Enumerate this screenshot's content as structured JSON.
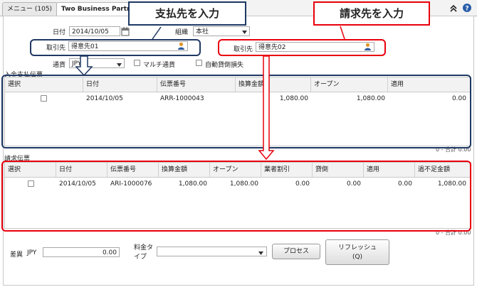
{
  "tabs": [
    {
      "label": "メニュー (105)",
      "active": false
    },
    {
      "label": "Two Business Partner",
      "active": true
    }
  ],
  "form": {
    "date_label": "日付",
    "date_value": "2014/10/05",
    "org_label": "組織",
    "org_value": "本社",
    "payee_label": "取引先",
    "payee_value": "得意先01",
    "billing_label": "取引先",
    "billing_value": "得意先02",
    "currency_label": "通貨",
    "currency_value": "JPY",
    "multi_currency_label": "マルチ通貨",
    "auto_writeoff_label": "自動貸倒損失"
  },
  "payment_grid": {
    "title": "入金支払伝票",
    "columns": [
      "選択",
      "日付",
      "伝票番号",
      "換算金額",
      "オープン",
      "適用"
    ],
    "rows": [
      {
        "date": "2014/10/05",
        "doc": "ARR-1000043",
        "converted": "1,080.00",
        "open": "1,080.00",
        "applied": "0.00"
      }
    ],
    "total": "0 - 合計 0.00"
  },
  "invoice_grid": {
    "title": "請求伝票",
    "columns": [
      "選択",
      "日付",
      "伝票番号",
      "換算金額",
      "オープン",
      "業者割引",
      "貸倒",
      "適用",
      "過不足金額"
    ],
    "rows": [
      {
        "date": "2014/10/05",
        "doc": "ARI-1000076",
        "converted": "1,080.00",
        "open": "1,080.00",
        "discount": "0.00",
        "writeoff": "0.00",
        "applied": "0.00",
        "overunder": "1,080.00"
      }
    ],
    "total": "0 - 合計 0.00"
  },
  "footer": {
    "diff_label": "差異",
    "diff_currency": "JPY",
    "diff_value": "0.00",
    "charge_type_label": "料金タイプ",
    "process_label": "プロセス",
    "refresh_label_line1": "リフレッシュ",
    "refresh_label_line2": "(Q)"
  },
  "annotations": {
    "payee_callout": "支払先を入力",
    "billing_callout": "請求先を入力",
    "blue": "#1f3864",
    "red": "#e8000b"
  }
}
